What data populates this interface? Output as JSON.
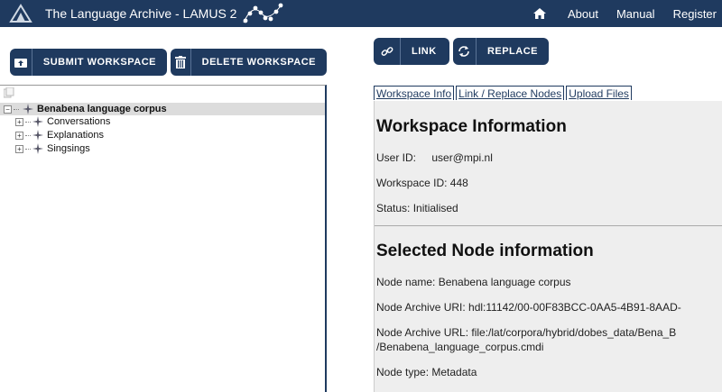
{
  "header": {
    "title": "The Language Archive - LAMUS 2",
    "nav": [
      "About",
      "Manual",
      "Register"
    ]
  },
  "toolbar_left": {
    "submit_label": "SUBMIT WORKSPACE",
    "delete_label": "DELETE WORKSPACE"
  },
  "toolbar_right": {
    "link_label": "LINK",
    "replace_label": "REPLACE"
  },
  "tree": {
    "root": "Benabena language corpus",
    "children": [
      "Conversations",
      "Explanations",
      "Singsings"
    ]
  },
  "tabs": [
    "Workspace Info",
    "Link / Replace Nodes",
    "Upload Files"
  ],
  "workspace": {
    "title": "Workspace Information",
    "user_id_label": "User ID:",
    "user_id": "user@mpi.nl",
    "workspace_id": "Workspace ID: 448",
    "status": "Status: Initialised"
  },
  "node": {
    "title": "Selected Node information",
    "name": "Node name: Benabena language corpus",
    "archive_uri": "Node Archive URI: hdl:11142/00-00F83BCC-0AA5-4B91-8AAD-",
    "archive_url_1": "Node Archive URL: file:/lat/corpora/hybrid/dobes_data/Bena_B",
    "archive_url_2": "/Benabena_language_corpus.cmdi",
    "type": "Node type: Metadata"
  },
  "colors": {
    "primary": "#1f3a5f",
    "content_bg": "#eeeeee",
    "selected_row": "#dcdcdc"
  }
}
